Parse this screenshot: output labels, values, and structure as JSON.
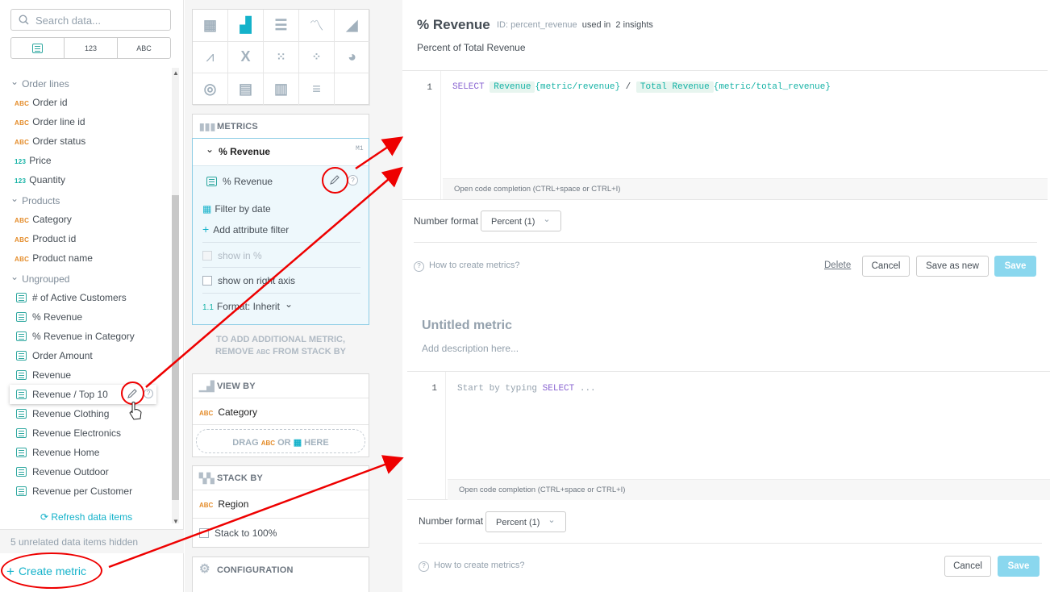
{
  "left": {
    "search_placeholder": "Search data...",
    "filters": [
      "",
      "123",
      "ABC"
    ],
    "groups": [
      {
        "label": "Order lines"
      },
      {
        "label": "Products"
      },
      {
        "label": "Ungrouped"
      }
    ],
    "items": [
      {
        "type": "ABC",
        "label": "Order id"
      },
      {
        "type": "ABC",
        "label": "Order line id"
      },
      {
        "type": "ABC",
        "label": "Order status"
      },
      {
        "type": "123",
        "label": "Price"
      },
      {
        "type": "123",
        "label": "Quantity"
      },
      {
        "type": "ABC",
        "label": "Category"
      },
      {
        "type": "ABC",
        "label": "Product id"
      },
      {
        "type": "ABC",
        "label": "Product name"
      },
      {
        "type": "metric",
        "label": "# of Active Customers"
      },
      {
        "type": "metric",
        "label": "% Revenue"
      },
      {
        "type": "metric",
        "label": "% Revenue in Category"
      },
      {
        "type": "metric",
        "label": "Order Amount"
      },
      {
        "type": "metric",
        "label": "Revenue"
      },
      {
        "type": "metric",
        "label": "Revenue / Top 10"
      },
      {
        "type": "metric",
        "label": "Revenue Clothing"
      },
      {
        "type": "metric",
        "label": "Revenue Electronics"
      },
      {
        "type": "metric",
        "label": "Revenue Home"
      },
      {
        "type": "metric",
        "label": "Revenue Outdoor"
      },
      {
        "type": "metric",
        "label": "Revenue per Customer"
      }
    ],
    "refresh": "Refresh data items",
    "hidden_note": "5 unrelated data items hidden",
    "create_metric": "Create metric"
  },
  "mid": {
    "metrics_title": "METRICS",
    "metric_name": "% Revenue",
    "metric_id": "M1",
    "metric_item": "% Revenue",
    "filter_by_date": "Filter by date",
    "add_attribute_filter": "Add attribute filter",
    "show_in_percent": "show in %",
    "show_on_right_axis": "show on right axis",
    "format_icon": "1.1",
    "format_label": "Format: Inherit",
    "hint_line1": "TO ADD ADDITIONAL METRIC,",
    "hint_line2a": "REMOVE",
    "hint_line2b": "ABC",
    "hint_line2c": "FROM STACK BY",
    "view_by_title": "VIEW BY",
    "view_by_item": "Category",
    "drag_a": "DRAG",
    "drag_b": "ABC",
    "drag_c": "OR",
    "drag_d": "HERE",
    "stack_by_title": "STACK BY",
    "stack_by_item": "Region",
    "stack_to_100": "Stack to 100%",
    "configuration_title": "CONFIGURATION"
  },
  "editor1": {
    "title": "% Revenue",
    "id_label": "ID: percent_revenue",
    "used_in": "used in",
    "insights": "2 insights",
    "description": "Percent of Total Revenue",
    "line_no": "1",
    "code_select": "SELECT",
    "code_tag1": "Revenue",
    "code_ref1": "{metric/revenue}",
    "code_div": "/",
    "code_tag2": "Total Revenue",
    "code_ref2": "{metric/total_revenue}",
    "completion_hint": "Open code completion (CTRL+space or CTRL+I)",
    "number_format_label": "Number format",
    "number_format_value": "Percent (1)",
    "help": "How to create metrics?",
    "delete": "Delete",
    "cancel": "Cancel",
    "save_as_new": "Save as new",
    "save": "Save"
  },
  "editor2": {
    "title": "Untitled metric",
    "description_placeholder": "Add description here...",
    "line_no": "1",
    "code_placeholder_a": "Start by typing",
    "code_placeholder_kw": "SELECT",
    "code_placeholder_b": "...",
    "completion_hint": "Open code completion (CTRL+space or CTRL+I)",
    "number_format_label": "Number format",
    "number_format_value": "Percent (1)",
    "help": "How to create metrics?",
    "cancel": "Cancel",
    "save": "Save"
  },
  "colors": {
    "accent": "#14b2ca",
    "annotation": "#e00000",
    "metric_teal": "#14b2a5",
    "attr_orange": "#e48c2a"
  }
}
